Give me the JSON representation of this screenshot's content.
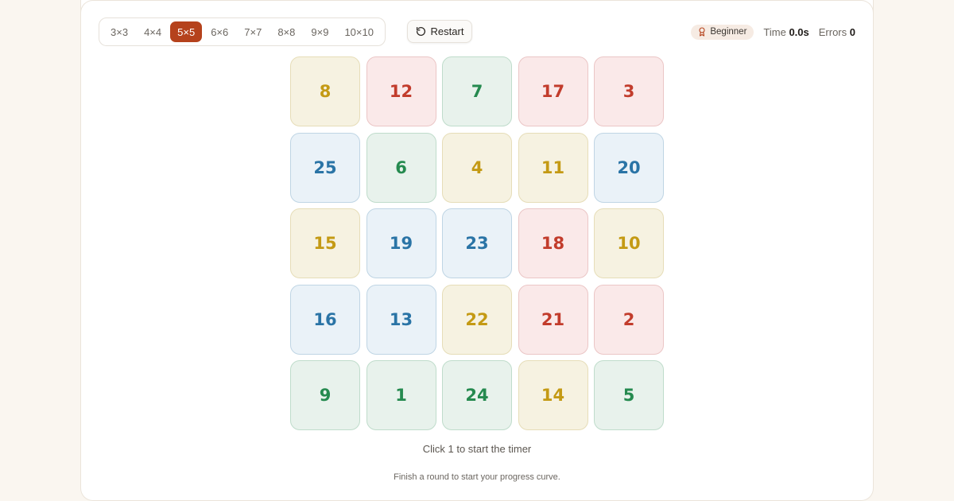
{
  "sizes": [
    "3×3",
    "4×4",
    "5×5",
    "6×6",
    "7×7",
    "8×8",
    "9×9",
    "10×10"
  ],
  "active_size": "5×5",
  "restart_label": "Restart",
  "stats": {
    "level": "Beginner",
    "time_label": "Time",
    "time_value": "0.0s",
    "errors_label": "Errors",
    "errors_value": "0"
  },
  "tiles": [
    {
      "n": "8",
      "color": "yellow"
    },
    {
      "n": "12",
      "color": "red"
    },
    {
      "n": "7",
      "color": "green"
    },
    {
      "n": "17",
      "color": "red"
    },
    {
      "n": "3",
      "color": "red"
    },
    {
      "n": "25",
      "color": "blue"
    },
    {
      "n": "6",
      "color": "green"
    },
    {
      "n": "4",
      "color": "yellow"
    },
    {
      "n": "11",
      "color": "yellow"
    },
    {
      "n": "20",
      "color": "blue"
    },
    {
      "n": "15",
      "color": "yellow"
    },
    {
      "n": "19",
      "color": "blue"
    },
    {
      "n": "23",
      "color": "blue"
    },
    {
      "n": "18",
      "color": "red"
    },
    {
      "n": "10",
      "color": "yellow"
    },
    {
      "n": "16",
      "color": "blue"
    },
    {
      "n": "13",
      "color": "blue"
    },
    {
      "n": "22",
      "color": "yellow"
    },
    {
      "n": "21",
      "color": "red"
    },
    {
      "n": "2",
      "color": "red"
    },
    {
      "n": "9",
      "color": "green"
    },
    {
      "n": "1",
      "color": "green"
    },
    {
      "n": "24",
      "color": "green"
    },
    {
      "n": "14",
      "color": "yellow"
    },
    {
      "n": "5",
      "color": "green"
    }
  ],
  "hint": "Click 1 to start the timer",
  "progress_note": "Finish a round to start your progress curve.",
  "colors": {
    "accent": "#b5421c",
    "yellow": "#c49a14",
    "red": "#c23c2c",
    "green": "#258a4f",
    "blue": "#2a74a6"
  },
  "icons": {
    "restart": "rotate-ccw-icon",
    "level": "award-icon"
  }
}
